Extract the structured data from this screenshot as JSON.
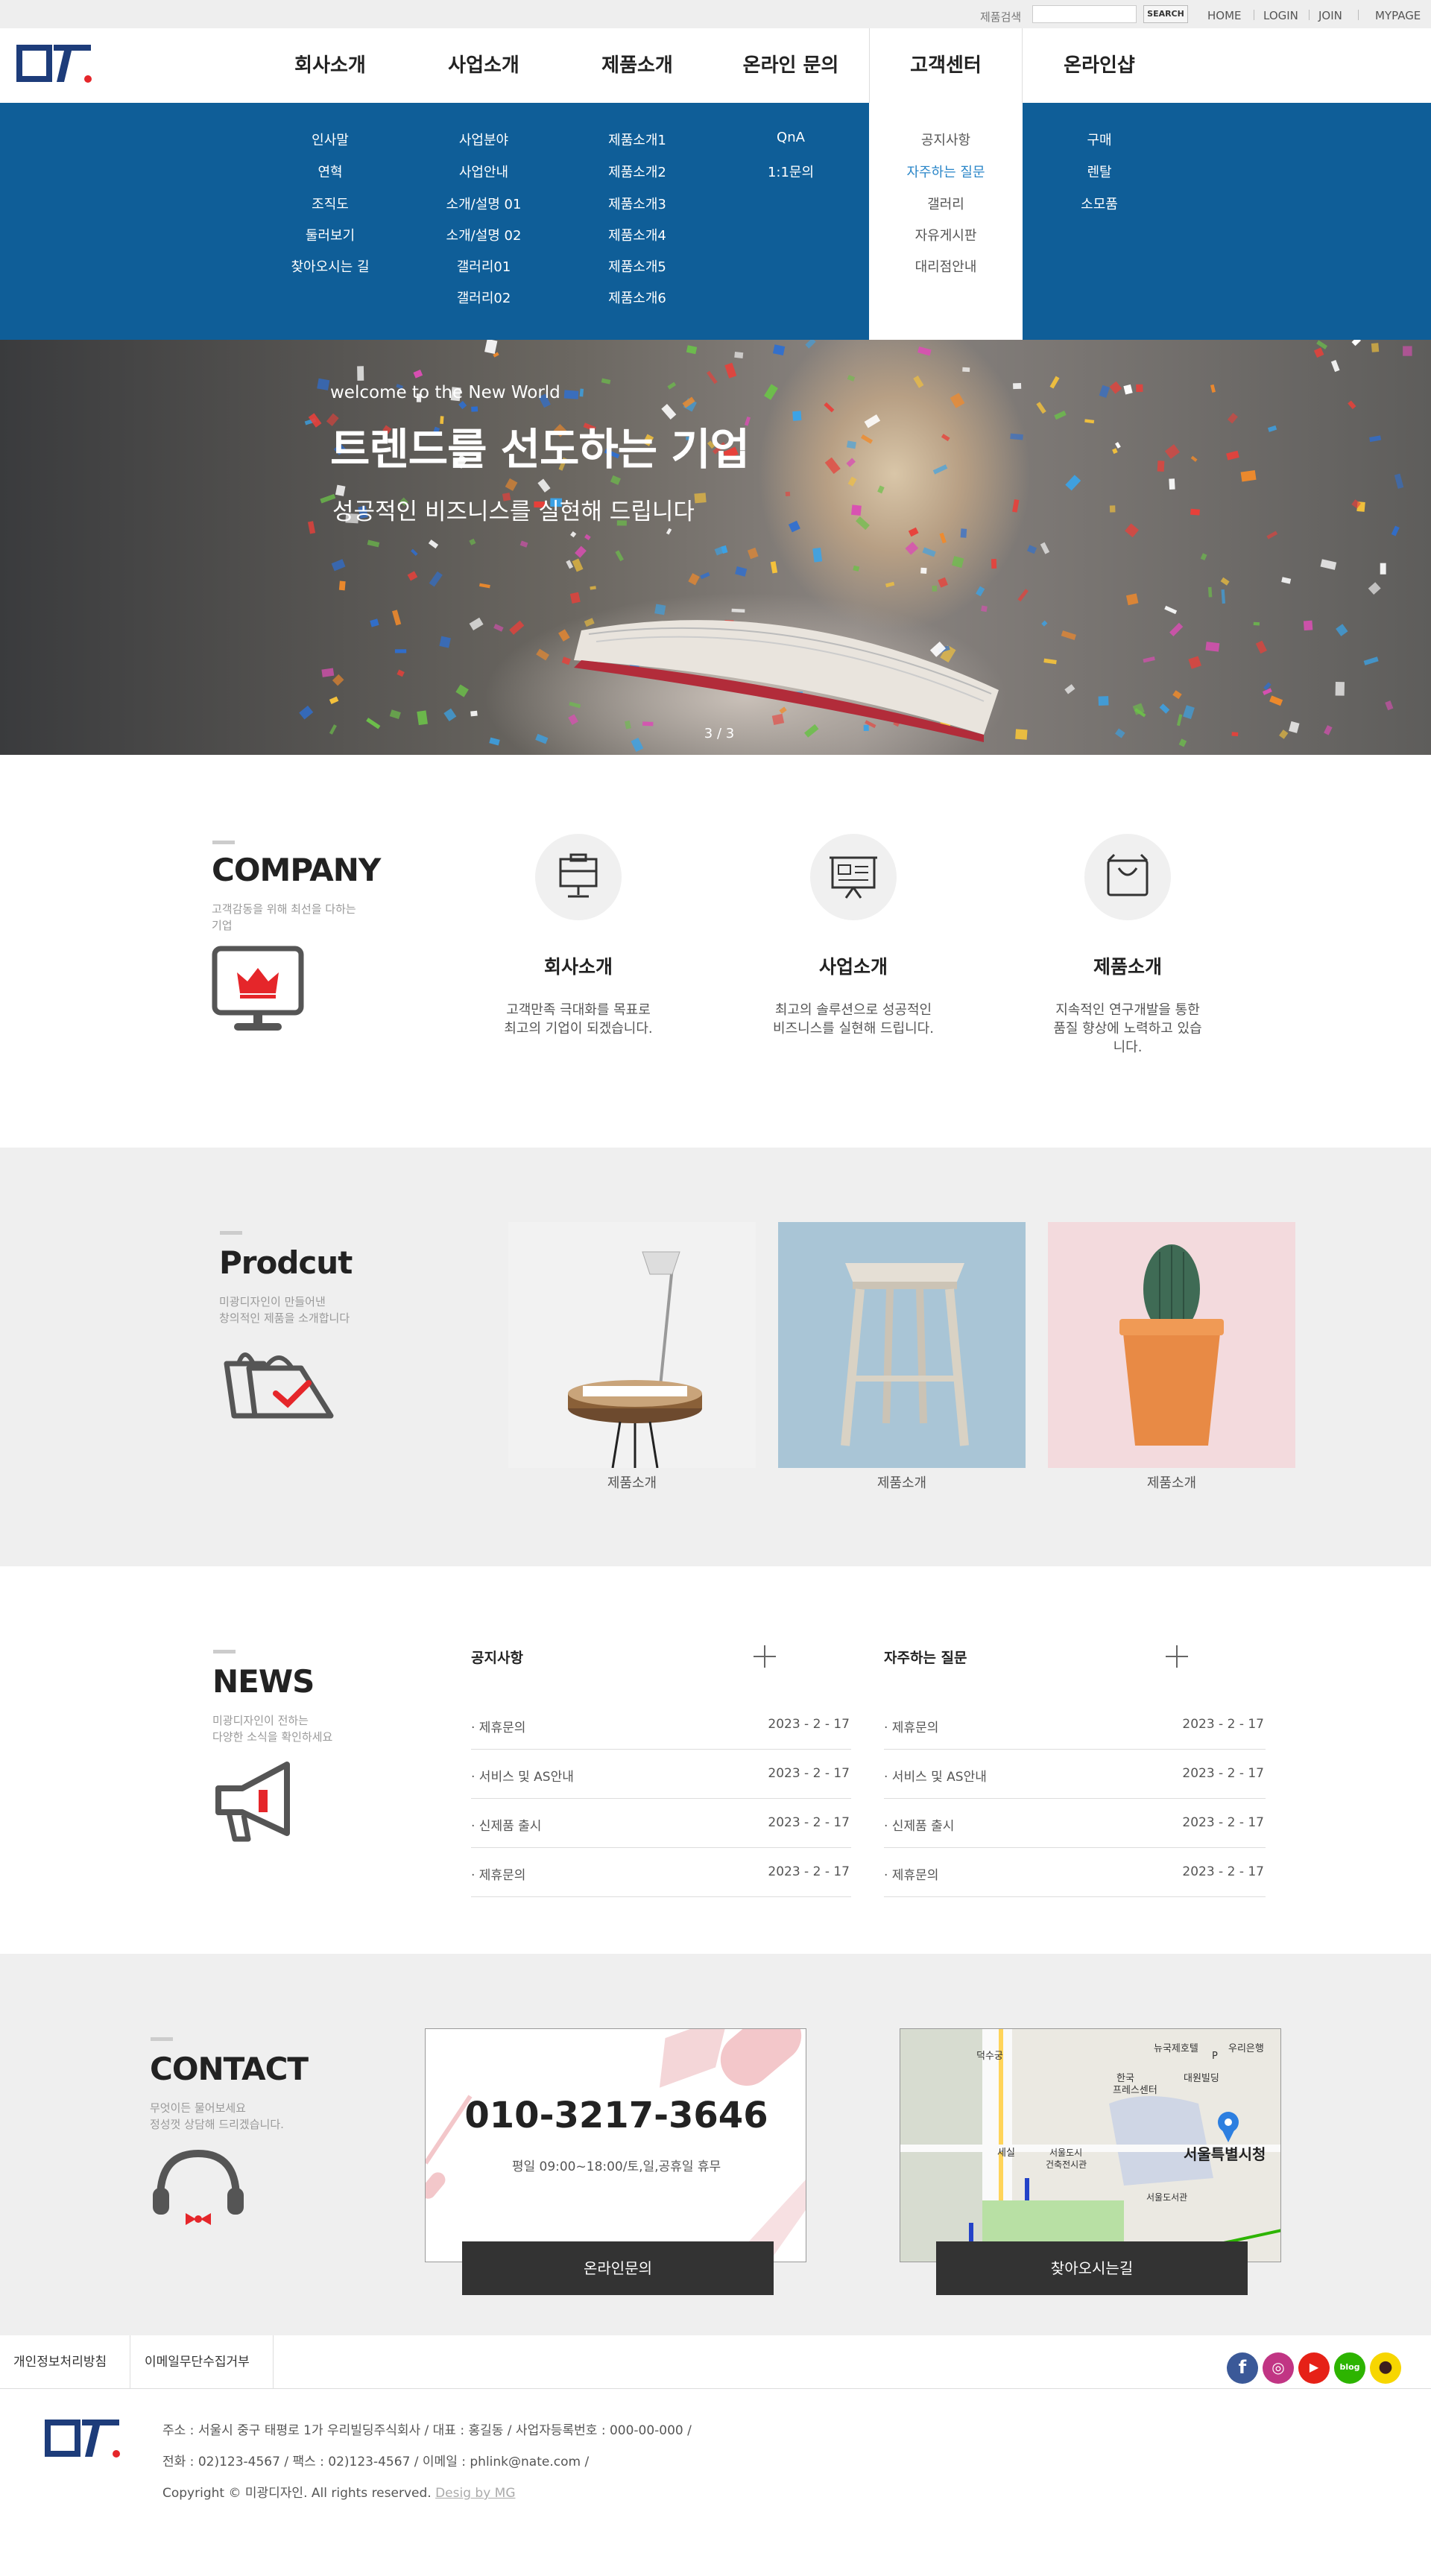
{
  "topbar": {
    "search_label": "제품검색",
    "search_placeholder": "",
    "search_button": "SEARCH",
    "links": [
      "HOME",
      "LOGIN",
      "JOIN",
      "MYPAGE"
    ]
  },
  "logo": {
    "text": "ㄷㄱ",
    "color": "#1d3c7a",
    "dot_color": "#e5262a"
  },
  "nav": {
    "menus": [
      {
        "label": "회사소개",
        "items": [
          "인사말",
          "연혁",
          "조직도",
          "둘러보기",
          "찾아오시는 길"
        ]
      },
      {
        "label": "사업소개",
        "items": [
          "사업분야",
          "사업안내",
          "소개/설명 01",
          "소개/설명 02",
          "갤러리01",
          "갤러리02"
        ]
      },
      {
        "label": "제품소개",
        "items": [
          "제품소개1",
          "제품소개2",
          "제품소개3",
          "제품소개4",
          "제품소개5",
          "제품소개6"
        ]
      },
      {
        "label": "온라인 문의",
        "items": [
          "QnA",
          "1:1문의"
        ]
      },
      {
        "label": "고객센터",
        "items": [
          "공지사항",
          "자주하는 질문",
          "갤러리",
          "자유게시판",
          "대리점안내"
        ],
        "active_item": "자주하는 질문"
      },
      {
        "label": "온라인샵",
        "items": [
          "구매",
          "렌탈",
          "소모품"
        ]
      }
    ],
    "mega_bg": "#0f5e98"
  },
  "hero": {
    "subtitle": "welcome to the New World",
    "title": "트렌드를 선도하는 기업",
    "description": "성공적인 비즈니스를 실현해 드립니다",
    "pager": "3 / 3"
  },
  "company": {
    "title": "COMPANY",
    "desc_line1": "고객감동을 위해 최선을 다하는",
    "desc_line2": "기업",
    "features": [
      {
        "title": "회사소개",
        "line1": "고객만족 극대화를 목표로",
        "line2": "최고의 기업이 되겠습니다.",
        "line3": ""
      },
      {
        "title": "사업소개",
        "line1": "최고의 솔루션으로 성공적인",
        "line2": "비즈니스를 실현해 드립니다.",
        "line3": ""
      },
      {
        "title": "제품소개",
        "line1": "지속적인 연구개발을 통한",
        "line2": "품질 향상에 노력하고 있습",
        "line3": "니다."
      }
    ]
  },
  "product": {
    "title": "Prodcut",
    "desc_line1": "미광디자인이 만들어낸",
    "desc_line2": "창의적인 제품을 소개합니다",
    "items": [
      {
        "caption": "제품소개",
        "icon": "stool-lamp"
      },
      {
        "caption": "제품소개",
        "icon": "wooden-stool"
      },
      {
        "caption": "제품소개",
        "icon": "cactus-pot"
      }
    ]
  },
  "news": {
    "title": "NEWS",
    "desc_line1": "미광디자인이 전하는",
    "desc_line2": "다양한 소식을 확인하세요",
    "boards": [
      {
        "heading": "공지사항",
        "rows": [
          {
            "title": "· 제휴문의",
            "date": "2023 - 2 - 17"
          },
          {
            "title": "· 서비스 및 AS안내",
            "date": "2023 - 2 - 17"
          },
          {
            "title": "· 신제품 출시",
            "date": "2023 - 2 - 17"
          },
          {
            "title": "· 제휴문의",
            "date": "2023 - 2 - 17"
          }
        ]
      },
      {
        "heading": "자주하는 질문",
        "rows": [
          {
            "title": "· 제휴문의",
            "date": "2023 - 2 - 17"
          },
          {
            "title": "· 서비스 및 AS안내",
            "date": "2023 - 2 - 17"
          },
          {
            "title": "· 신제품 출시",
            "date": "2023 - 2 - 17"
          },
          {
            "title": "· 제휴문의",
            "date": "2023 - 2 - 17"
          }
        ]
      }
    ]
  },
  "contact": {
    "title": "CONTACT",
    "desc_line1": "무엇이든 물어보세요",
    "desc_line2": "정성껏 상담해 드리겠습니다.",
    "phone": "010-3217-3646",
    "hours": "평일 09:00~18:00/토,일,공휴일 휴무",
    "inquiry_button": "온라인문의",
    "map_button": "찾아오시는길",
    "map_labels": [
      "뉴국제호텔",
      "우리은행",
      "한국프레스센터",
      "대원빌딩",
      "서울특별시청",
      "서울도시건축전시관",
      "서울도서관",
      "세실",
      "덕수궁",
      "P"
    ]
  },
  "footer": {
    "links": [
      "개인정보처리방침",
      "이메일무단수집거부"
    ],
    "social": [
      {
        "name": "facebook-icon",
        "color": "#3b5998",
        "glyph": "f"
      },
      {
        "name": "instagram-icon",
        "color": "#c13584",
        "glyph": "◎"
      },
      {
        "name": "youtube-icon",
        "color": "#e62117",
        "glyph": "▶"
      },
      {
        "name": "blog-icon",
        "color": "#2db400",
        "glyph": "blog"
      },
      {
        "name": "kakao-icon",
        "color": "#f7d600",
        "glyph": "●"
      }
    ],
    "address": "주소 : 서울시 중구 태평로 1가 우리빌딩주식회사 / 대표 : 홍길동 / 사업자등록번호 : 000-00-000 /",
    "contact": "전화 : 02)123-4567 / 팩스 : 02)123-4567 / 이메일 : phlink@nate.com /",
    "copyright": "Copyright © 미광디자인. All rights reserved.",
    "credit": "Desig by MG"
  }
}
